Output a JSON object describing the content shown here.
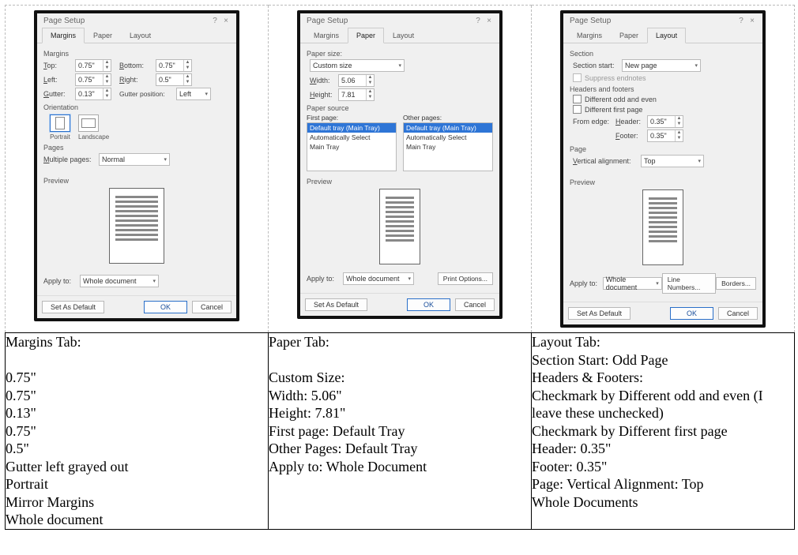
{
  "dialog_title": "Page Setup",
  "tabs": {
    "margins": "Margins",
    "paper": "Paper",
    "layout": "Layout"
  },
  "common": {
    "apply_to_label": "Apply to:",
    "apply_to_value": "Whole document",
    "set_default": "Set As Default",
    "ok": "OK",
    "cancel": "Cancel",
    "preview": "Preview",
    "help": "?",
    "close": "×"
  },
  "margins": {
    "section": "Margins",
    "top_label": "Top:",
    "top": "0.75\"",
    "bottom_label": "Bottom:",
    "bottom": "0.75\"",
    "left_label": "Left:",
    "left": "0.75\"",
    "right_label": "Right:",
    "right": "0.5\"",
    "gutter_label": "Gutter:",
    "gutter": "0.13\"",
    "gutter_pos_label": "Gutter position:",
    "gutter_pos": "Left",
    "orientation": "Orientation",
    "portrait": "Portrait",
    "landscape": "Landscape",
    "pages": "Pages",
    "multiple_label": "Multiple pages:",
    "multiple_value": "Normal"
  },
  "paper": {
    "size_section": "Paper size:",
    "size_value": "Custom size",
    "width_label": "Width:",
    "width": "5.06",
    "height_label": "Height:",
    "height": "7.81",
    "source_section": "Paper source",
    "first_page": "First page:",
    "other_pages": "Other pages:",
    "options": [
      "Default tray (Main Tray)",
      "Automatically Select",
      "Main Tray"
    ],
    "print_options": "Print Options..."
  },
  "layout": {
    "section_label": "Section",
    "section_start_label": "Section start:",
    "section_start_value": "New page",
    "suppress": "Suppress endnotes",
    "hf_section": "Headers and footers",
    "diff_oddeven": "Different odd and even",
    "diff_first": "Different first page",
    "from_edge": "From edge:",
    "header_label": "Header:",
    "header": "0.35\"",
    "footer_label": "Footer:",
    "footer": "0.35\"",
    "page_section": "Page",
    "valign_label": "Vertical alignment:",
    "valign": "Top",
    "line_numbers": "Line Numbers...",
    "borders": "Borders..."
  },
  "descriptions": {
    "col1": [
      "Margins Tab:",
      "",
      "0.75\"",
      "0.75\"",
      "0.13\"",
      "0.75\"",
      "0.5\"",
      "Gutter left grayed out",
      "Portrait",
      "Mirror Margins",
      "Whole document"
    ],
    "col2": [
      "Paper Tab:",
      "",
      "Custom Size:",
      "Width:  5.06\"",
      "Height: 7.81\"",
      "First page:  Default Tray",
      "Other Pages:  Default Tray",
      "Apply to:  Whole Document"
    ],
    "col3": [
      "Layout Tab:",
      "Section Start:  Odd Page",
      "Headers & Footers:",
      "Checkmark by Different odd and even (I leave these unchecked)",
      "Checkmark by Different first page",
      "Header:  0.35\"",
      "Footer: 0.35\"",
      "Page:  Vertical Alignment:  Top",
      "Whole Documents"
    ]
  }
}
